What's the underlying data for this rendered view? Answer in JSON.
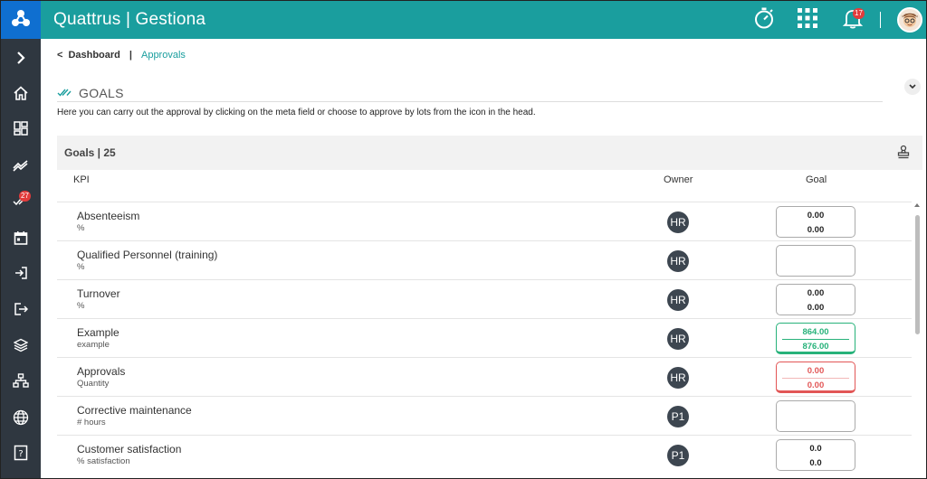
{
  "app": {
    "brand": "Quattrus | Gestiona",
    "notifications_count": "17",
    "colors": {
      "header": "#1a9e9e",
      "logo_bg": "#0f6fd0",
      "sidebar": "#2f3740",
      "success": "#27b27a",
      "danger": "#e25656"
    }
  },
  "sidebar": {
    "items": [
      {
        "name": "expand",
        "icon": "chevron-right-icon"
      },
      {
        "name": "home",
        "icon": "home-icon"
      },
      {
        "name": "dashboard",
        "icon": "dashboard-grid-icon"
      },
      {
        "name": "indicators",
        "icon": "trend-lines-icon"
      },
      {
        "name": "approvals",
        "icon": "double-check-icon",
        "badge": "27"
      },
      {
        "name": "calendar",
        "icon": "calendar-icon"
      },
      {
        "name": "login",
        "icon": "login-icon"
      },
      {
        "name": "logout",
        "icon": "logout-icon"
      },
      {
        "name": "layers",
        "icon": "layers-icon"
      },
      {
        "name": "org-chart",
        "icon": "org-chart-icon"
      },
      {
        "name": "web",
        "icon": "globe-icon"
      },
      {
        "name": "help",
        "icon": "help-icon"
      }
    ]
  },
  "breadcrumb": {
    "back": "<",
    "dashboard": "Dashboard",
    "separator": "|",
    "current": "Approvals"
  },
  "section": {
    "title": "GOALS",
    "description": "Here you can carry out the approval by clicking on the meta field or choose to approve by lots from the icon in the head."
  },
  "panel": {
    "title": "Goals | 25"
  },
  "table": {
    "columns": {
      "kpi": "KPI",
      "owner": "Owner",
      "goal": "Goal"
    },
    "rows": [
      {
        "kpi": "Absenteeism",
        "unit": "%",
        "owner": "HR",
        "goal1": "0.00",
        "goal2": "0.00",
        "state": "default"
      },
      {
        "kpi": "Qualified Personnel (training)",
        "unit": "%",
        "owner": "HR",
        "goal1": "",
        "goal2": "",
        "state": "empty"
      },
      {
        "kpi": "Turnover",
        "unit": "%",
        "owner": "HR",
        "goal1": "0.00",
        "goal2": "0.00",
        "state": "default"
      },
      {
        "kpi": "Example",
        "unit": "example",
        "owner": "HR",
        "goal1": "864.00",
        "goal2": "876.00",
        "state": "green"
      },
      {
        "kpi": "Approvals",
        "unit": "Quantity",
        "owner": "HR",
        "goal1": "0.00",
        "goal2": "0.00",
        "state": "red"
      },
      {
        "kpi": "Corrective maintenance",
        "unit": "# hours",
        "owner": "P1",
        "goal1": "",
        "goal2": "",
        "state": "empty"
      },
      {
        "kpi": "Customer satisfaction",
        "unit": "% satisfaction",
        "owner": "P1",
        "goal1": "0.0",
        "goal2": "0.0",
        "state": "default"
      }
    ]
  }
}
